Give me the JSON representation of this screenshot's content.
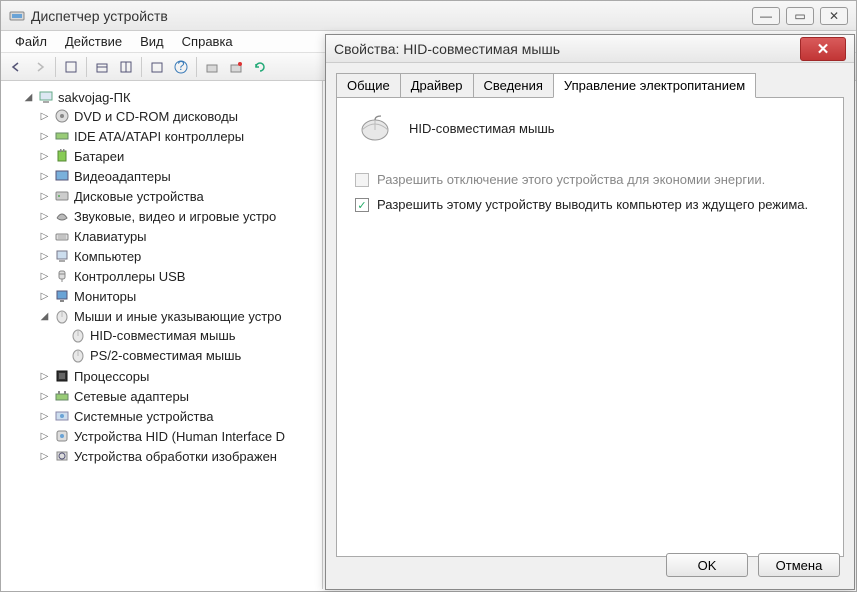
{
  "device_manager": {
    "title": "Диспетчер устройств",
    "menu": {
      "file": "Файл",
      "action": "Действие",
      "view": "Вид",
      "help": "Справка"
    },
    "root": "sakvojag-ПК",
    "nodes": [
      {
        "label": "DVD и CD-ROM дисководы"
      },
      {
        "label": "IDE ATA/ATAPI контроллеры"
      },
      {
        "label": "Батареи"
      },
      {
        "label": "Видеоадаптеры"
      },
      {
        "label": "Дисковые устройства"
      },
      {
        "label": "Звуковые, видео и игровые устро"
      },
      {
        "label": "Клавиатуры"
      },
      {
        "label": "Компьютер"
      },
      {
        "label": "Контроллеры USB"
      },
      {
        "label": "Мониторы"
      },
      {
        "label": "Мыши и иные указывающие устро",
        "expanded": true,
        "children": [
          {
            "label": "HID-совместимая мышь"
          },
          {
            "label": "PS/2-совместимая мышь"
          }
        ]
      },
      {
        "label": "Процессоры"
      },
      {
        "label": "Сетевые адаптеры"
      },
      {
        "label": "Системные устройства"
      },
      {
        "label": "Устройства HID (Human Interface D"
      },
      {
        "label": "Устройства обработки изображен"
      }
    ]
  },
  "properties": {
    "title": "Свойства: HID-совместимая мышь",
    "tabs": {
      "general": "Общие",
      "driver": "Драйвер",
      "details": "Сведения",
      "power": "Управление электропитанием"
    },
    "device_name": "HID-совместимая мышь",
    "opt1": "Разрешить отключение этого устройства для экономии энергии.",
    "opt2": "Разрешить этому устройству выводить компьютер из ждущего режима.",
    "ok": "OK",
    "cancel": "Отмена"
  }
}
